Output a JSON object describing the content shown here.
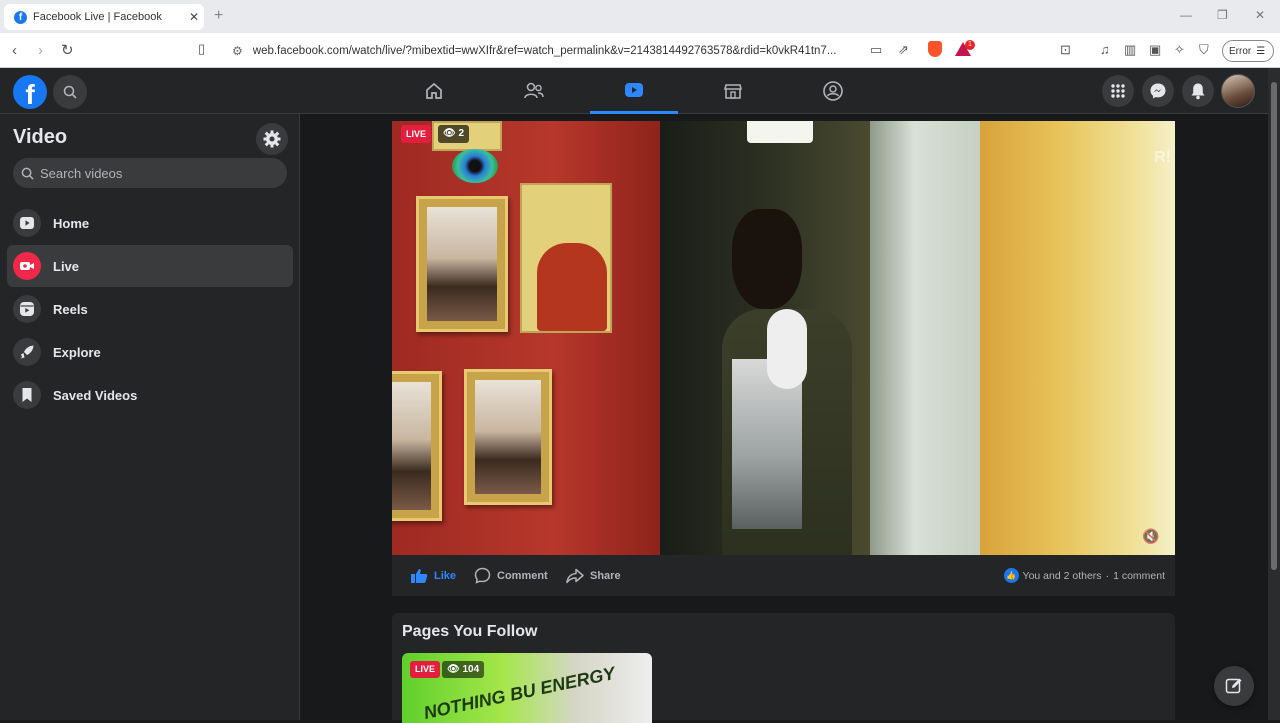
{
  "browser": {
    "tab_title": "Facebook Live | Facebook",
    "tab_favicon": "f",
    "url": "web.facebook.com/watch/live/?mibextid=wwXIfr&ref=watch_permalink&v=2143814492763578&rdid=k0vkR41tn7...",
    "rewards_badge": "1",
    "error_label": "Error"
  },
  "fb": {
    "logo": "f",
    "nav": [
      {
        "name": "home"
      },
      {
        "name": "friends"
      },
      {
        "name": "video",
        "active": true
      },
      {
        "name": "marketplace"
      },
      {
        "name": "groups"
      }
    ]
  },
  "sidebar": {
    "title": "Video",
    "search_placeholder": "Search videos",
    "items": [
      {
        "label": "Home",
        "icon": "play-icon"
      },
      {
        "label": "Live",
        "icon": "live-camera-icon",
        "active": true
      },
      {
        "label": "Reels",
        "icon": "reels-icon"
      },
      {
        "label": "Explore",
        "icon": "rocket-icon"
      },
      {
        "label": "Saved Videos",
        "icon": "bookmark-icon"
      }
    ]
  },
  "video": {
    "live_label": "LIVE",
    "viewers": "2",
    "watermark": "R!"
  },
  "actions": {
    "like": "Like",
    "comment": "Comment",
    "share": "Share",
    "reactions": "You and 2 others",
    "separator": "·",
    "comments": "1 comment"
  },
  "pages": {
    "title": "Pages You Follow",
    "thumb_live": "LIVE",
    "thumb_viewers": "104",
    "thumb_text": "NOTHING BU ENERGY"
  },
  "colors": {
    "accent": "#2d88ff",
    "live_red": "#e41e3f",
    "bg": "#18191a",
    "surface": "#242526"
  }
}
